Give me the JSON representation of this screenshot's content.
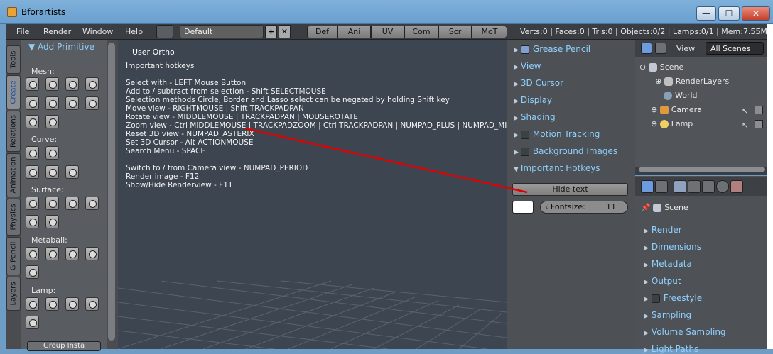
{
  "window": {
    "title": "Bforartists",
    "min": "—",
    "max": "☐",
    "close": "✕"
  },
  "menubar": {
    "menus": [
      "File",
      "Render",
      "Window",
      "Help"
    ],
    "layout": "Default",
    "add": "+",
    "remove": "✕",
    "workspace_tabs": [
      "Def",
      "Ani",
      "UV",
      "Com",
      "Scr",
      "MoT"
    ],
    "stats": "Verts:0 | Faces:0 | Tris:0 | Objects:0/2 | Lamps:0/1 | Mem:7.55M"
  },
  "toolshelf": {
    "tabs": [
      "Tools",
      "Create",
      "Relations",
      "Animation",
      "Physics",
      "G-Pencil",
      "Layers"
    ],
    "active_tab": "Create",
    "header": "Add Primitive",
    "sections": [
      "Mesh:",
      "Curve:",
      "Surface:",
      "Metaball:",
      "Lamp:"
    ],
    "group_instance": "Group Insta"
  },
  "viewport": {
    "title": "User Ortho",
    "hotkeys": [
      "Important hotkeys",
      "",
      "Select with - LEFT Mouse Button",
      "Add to / subtract from selection - Shift SELECTMOUSE",
      "Selection methods Circle, Border and Lasso select can be negated by holding Shift key",
      "Move view - RIGHTMOUSE  |  Shift TRACKPADPAN",
      "Rotate view - MIDDLEMOUSE  |  TRACKPADPAN  |  MOUSEROTATE",
      "Zoom view - Ctrl MIDDLEMOUSE  |  TRACKPADZOOM  |  Ctrl TRACKPADPAN  |  NUMPAD_PLUS  |  NUMPAD_MI",
      "Reset 3D view - NUMPAD_ASTERIX",
      "Set 3D Cursor - Alt ACTIONMOUSE",
      "Search Menu - SPACE",
      "",
      "Switch to / from Camera view - NUMPAD_PERIOD",
      "Render image - F12",
      "Show/Hide Renderview - F11"
    ]
  },
  "npanel": {
    "items": [
      {
        "label": "Grease Pencil",
        "checkbox": true,
        "checked": true
      },
      {
        "label": "View",
        "checkbox": false
      },
      {
        "label": "3D Cursor",
        "checkbox": false
      },
      {
        "label": "Display",
        "checkbox": false
      },
      {
        "label": "Shading",
        "checkbox": false
      },
      {
        "label": "Motion Tracking",
        "checkbox": true,
        "checked": false
      },
      {
        "label": "Background Images",
        "checkbox": true,
        "checked": false
      },
      {
        "label": "Important Hotkeys",
        "checkbox": false,
        "expanded": true
      }
    ],
    "hide_text": "Hide text",
    "fontsize_label": "Fontsize:",
    "fontsize_value": "11",
    "text_color": "#ffffff"
  },
  "outliner": {
    "view": "View",
    "scenes": "All Scenes",
    "rows": [
      "Scene",
      "RenderLayers",
      "World",
      "Camera",
      "Lamp"
    ]
  },
  "properties": {
    "scene": "Scene",
    "items": [
      "Render",
      "Dimensions",
      "Metadata",
      "Output",
      "Freestyle",
      "Sampling",
      "Volume Sampling",
      "Light Paths"
    ]
  },
  "colors": {
    "accent": "#8fd0ff",
    "annotation": "#e00000",
    "viewport_bg": "#3d4550"
  }
}
